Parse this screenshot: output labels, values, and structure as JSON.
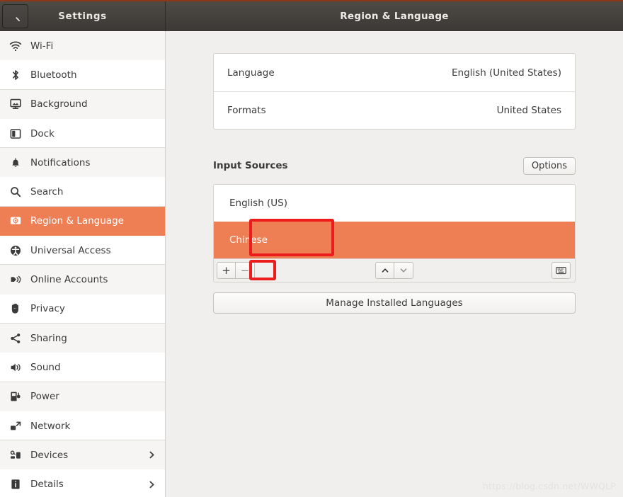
{
  "window": {
    "app_title": "Settings",
    "page_title": "Region & Language",
    "search_icon": "search-icon",
    "accent_color": "#ee7f54",
    "titlebar_color": "#413e3b",
    "annotation_color": "#ec1c1c",
    "background_color": "#f0efee"
  },
  "sidebar": {
    "items": [
      {
        "label": "Wi-Fi",
        "icon": "wifi-icon",
        "selected": false,
        "has_chevron": false
      },
      {
        "label": "Bluetooth",
        "icon": "bluetooth-icon",
        "selected": false,
        "has_chevron": false
      },
      {
        "label": "Background",
        "icon": "background-icon",
        "selected": false,
        "has_chevron": false
      },
      {
        "label": "Dock",
        "icon": "dock-icon",
        "selected": false,
        "has_chevron": false
      },
      {
        "label": "Notifications",
        "icon": "bell-icon",
        "selected": false,
        "has_chevron": false
      },
      {
        "label": "Search",
        "icon": "search-icon",
        "selected": false,
        "has_chevron": false
      },
      {
        "label": "Region & Language",
        "icon": "region-language-icon",
        "selected": true,
        "has_chevron": false
      },
      {
        "label": "Universal Access",
        "icon": "accessibility-icon",
        "selected": false,
        "has_chevron": false
      },
      {
        "label": "Online Accounts",
        "icon": "online-accounts-icon",
        "selected": false,
        "has_chevron": false
      },
      {
        "label": "Privacy",
        "icon": "hand-icon",
        "selected": false,
        "has_chevron": false
      },
      {
        "label": "Sharing",
        "icon": "share-icon",
        "selected": false,
        "has_chevron": false
      },
      {
        "label": "Sound",
        "icon": "speaker-icon",
        "selected": false,
        "has_chevron": false
      },
      {
        "label": "Power",
        "icon": "power-battery-icon",
        "selected": false,
        "has_chevron": false
      },
      {
        "label": "Network",
        "icon": "network-icon",
        "selected": false,
        "has_chevron": false
      },
      {
        "label": "Devices",
        "icon": "devices-icon",
        "selected": false,
        "has_chevron": true
      },
      {
        "label": "Details",
        "icon": "info-icon",
        "selected": false,
        "has_chevron": true
      }
    ]
  },
  "main": {
    "language_rows": [
      {
        "label": "Language",
        "value": "English (United States)"
      },
      {
        "label": "Formats",
        "value": "United States"
      }
    ],
    "input_sources": {
      "title": "Input Sources",
      "options_label": "Options",
      "sources": [
        {
          "label": "English (US)",
          "selected": false
        },
        {
          "label": "Chinese",
          "selected": true
        }
      ],
      "toolbar": {
        "add_label": "+",
        "remove_label": "−",
        "move_up_icon": "chevron-up-icon",
        "move_down_icon": "chevron-down-icon",
        "keyboard_icon": "keyboard-icon"
      }
    },
    "manage_languages_label": "Manage Installed Languages"
  },
  "watermark": {
    "text": "https://blog.csdn.net/WWQLP"
  }
}
